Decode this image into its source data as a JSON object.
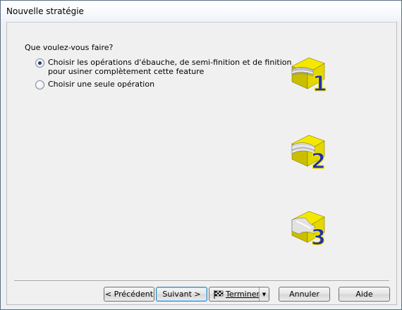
{
  "window": {
    "title": "Nouvelle stratégie"
  },
  "question": "Que voulez-vous faire?",
  "options": [
    {
      "label_line1": "Choisir les opérations d'ébauche, de semi-finition et de finition",
      "label_line2": "pour usiner complètement cette feature",
      "selected": true
    },
    {
      "label_line1": "Choisir une seule opération",
      "selected": false
    }
  ],
  "images": [
    {
      "name": "strategy-1-icon",
      "digit": "1"
    },
    {
      "name": "strategy-2-icon",
      "digit": "2"
    },
    {
      "name": "strategy-3-icon",
      "digit": "3"
    }
  ],
  "buttons": {
    "previous": "< Précédent",
    "next": "Suivant >",
    "finish": "Terminer",
    "cancel": "Annuler",
    "help": "Aide"
  },
  "colors": {
    "block_yellow": "#f5e800",
    "digit_blue": "#1f2fb0"
  }
}
